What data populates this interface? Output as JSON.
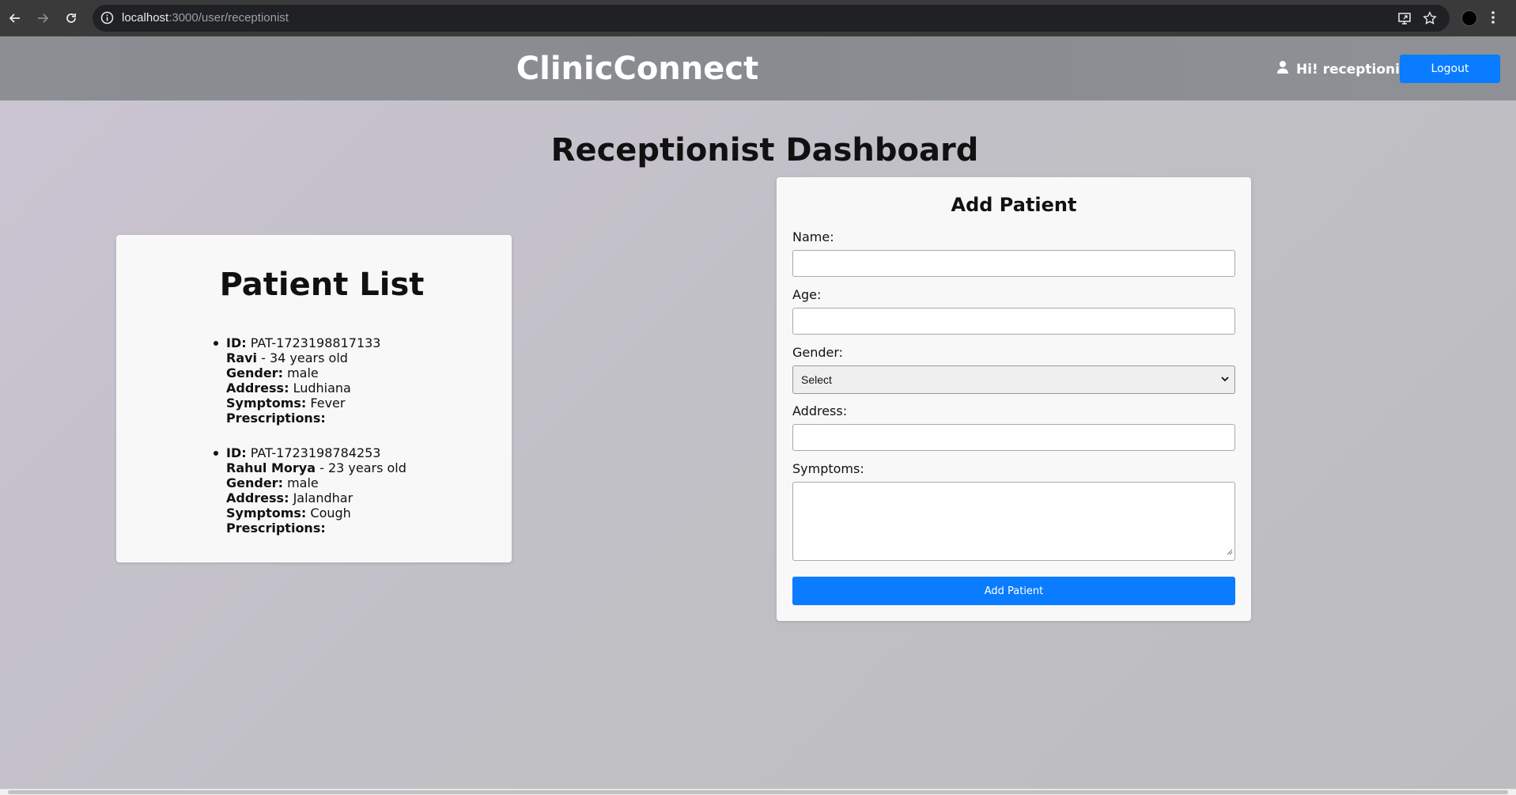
{
  "browser": {
    "url_host": "localhost",
    "url_path": ":3000/user/receptionist"
  },
  "navbar": {
    "brand": "ClinicConnect",
    "greeting": "Hi! receptionist",
    "logout_label": "Logout"
  },
  "page": {
    "title": "Receptionist Dashboard"
  },
  "patient_list": {
    "title": "Patient List",
    "labels": {
      "id": "ID:",
      "gender": "Gender:",
      "address": "Address:",
      "symptoms": "Symptoms:",
      "prescriptions": "Prescriptions:"
    },
    "patients": [
      {
        "id": "PAT-1723198817133",
        "name": "Ravi",
        "age_text": "- 34 years old",
        "gender": "male",
        "address": "Ludhiana",
        "symptoms": "Fever",
        "prescriptions": ""
      },
      {
        "id": "PAT-1723198784253",
        "name": "Rahul Morya",
        "age_text": "- 23 years old",
        "gender": "male",
        "address": "Jalandhar",
        "symptoms": "Cough",
        "prescriptions": ""
      }
    ]
  },
  "add_patient": {
    "title": "Add Patient",
    "name_label": "Name:",
    "name_value": "",
    "age_label": "Age:",
    "age_value": "",
    "gender_label": "Gender:",
    "gender_selected": "Select",
    "address_label": "Address:",
    "address_value": "",
    "symptoms_label": "Symptoms:",
    "symptoms_value": "",
    "submit_label": "Add Patient"
  },
  "colors": {
    "primary_button": "#0a7cff",
    "navbar_bg": "#8a8e92",
    "card_bg": "#f8f8f8"
  }
}
